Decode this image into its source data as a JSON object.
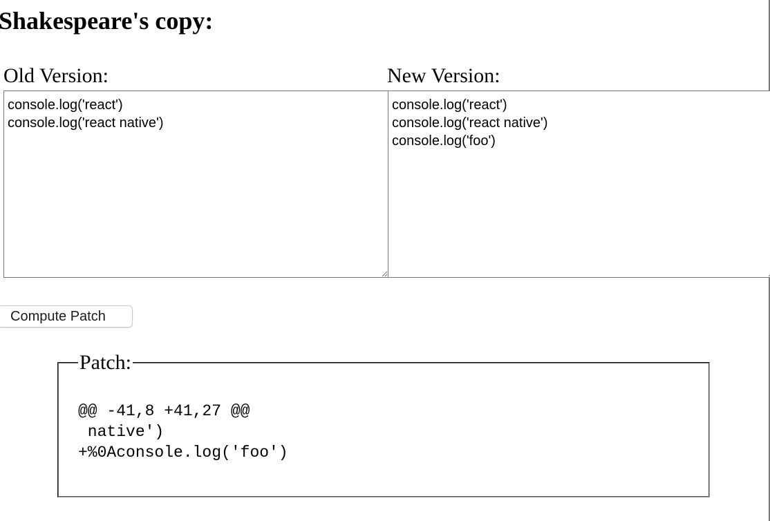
{
  "page": {
    "title": "Shakespeare's copy:"
  },
  "editor": {
    "old_label": "Old Version:",
    "new_label": "New Version:",
    "old_text": "console.log('react')\nconsole.log('react native')",
    "new_text": "console.log('react')\nconsole.log('react native')\nconsole.log('foo')"
  },
  "actions": {
    "compute_label": "Compute Patch"
  },
  "patch": {
    "legend": "Patch:",
    "text": "@@ -41,8 +41,27 @@\n native')\n+%0Aconsole.log('foo')"
  }
}
